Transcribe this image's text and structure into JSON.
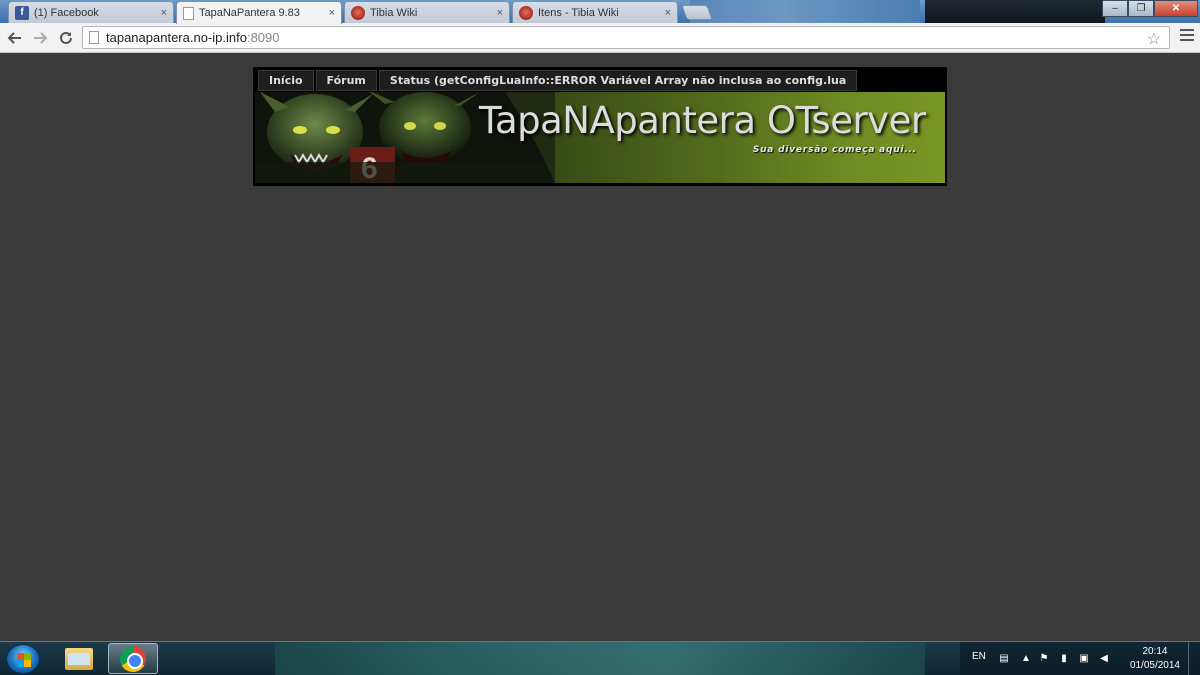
{
  "browser": {
    "tabs": [
      {
        "title": "(1) Facebook",
        "favicon": "facebook-icon",
        "active": false
      },
      {
        "title": "TapaNaPantera 9.83",
        "favicon": "page-icon",
        "active": true
      },
      {
        "title": "Tibia Wiki",
        "favicon": "tibiawiki-icon",
        "active": false
      },
      {
        "title": "Itens - Tibia Wiki",
        "favicon": "tibiawiki-icon",
        "active": false
      }
    ],
    "close_glyph": "×",
    "url": {
      "host": "tapanapantera.no-ip.info",
      "port": ":8090"
    },
    "window_buttons": {
      "minimize": "–",
      "maximize": "❐",
      "close": "✕"
    }
  },
  "site": {
    "nav": [
      "Início",
      "Fórum",
      "Status (getConfigLuaInfo::ERROR Variável Array não inclusa ao config.lua"
    ],
    "title": "TapaNApantera OTserver",
    "tagline": "Sua diversão começa aqui..."
  },
  "taskbar": {
    "language": "EN",
    "time": "20:14",
    "date": "01/05/2014"
  },
  "colors": {
    "page_bg": "#3a3a3a",
    "banner_green": "#6e8a22",
    "title_text": "#dcdcdc"
  }
}
